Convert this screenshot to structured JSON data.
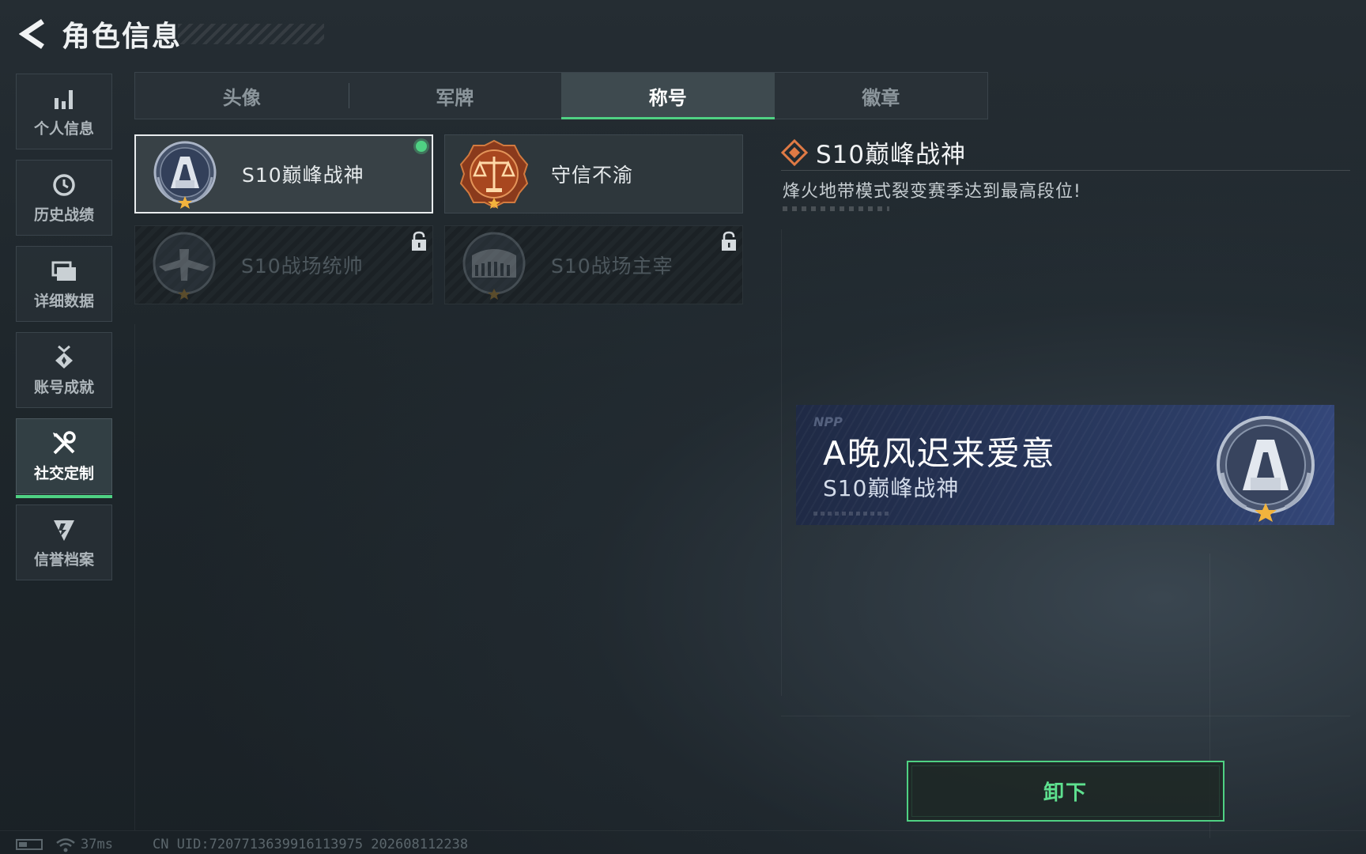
{
  "header": {
    "title": "角色信息"
  },
  "sidebar": {
    "items": [
      {
        "label": "个人信息",
        "icon": "bar-chart-icon",
        "active": false
      },
      {
        "label": "历史战绩",
        "icon": "clock-history-icon",
        "active": false
      },
      {
        "label": "详细数据",
        "icon": "folder-data-icon",
        "active": false
      },
      {
        "label": "账号成就",
        "icon": "medal-achievement-icon",
        "active": false
      },
      {
        "label": "社交定制",
        "icon": "tools-customize-icon",
        "active": true
      },
      {
        "label": "信誉档案",
        "icon": "shield-credit-icon",
        "active": false
      }
    ]
  },
  "tabs": [
    {
      "label": "头像",
      "active": false
    },
    {
      "label": "军牌",
      "active": false
    },
    {
      "label": "称号",
      "active": true
    },
    {
      "label": "徽章",
      "active": false
    }
  ],
  "titles": [
    {
      "label": "S10巅峰战神",
      "emblem": "peak-god-emblem",
      "selected": true,
      "equipped": true,
      "locked": false
    },
    {
      "label": "守信不渝",
      "emblem": "scales-justice-emblem",
      "selected": false,
      "equipped": false,
      "locked": false
    },
    {
      "label": "S10战场统帅",
      "emblem": "aircraft-emblem",
      "selected": false,
      "equipped": false,
      "locked": true
    },
    {
      "label": "S10战场主宰",
      "emblem": "colosseum-emblem",
      "selected": false,
      "equipped": false,
      "locked": true
    }
  ],
  "detail": {
    "title": "S10巅峰战神",
    "description": "烽火地带模式裂变赛季达到最高段位!"
  },
  "banner": {
    "logo": "NPP",
    "player_name": "A晚风迟来爱意",
    "title": "S10巅峰战神"
  },
  "unequip_button": {
    "label": "卸下"
  },
  "status_bar": {
    "ping": "37ms",
    "uid": "CN UID:7207713639916113975 202608112238"
  },
  "colors": {
    "accent_green": "#4fd183",
    "diamond_orange": "#e07a45"
  }
}
